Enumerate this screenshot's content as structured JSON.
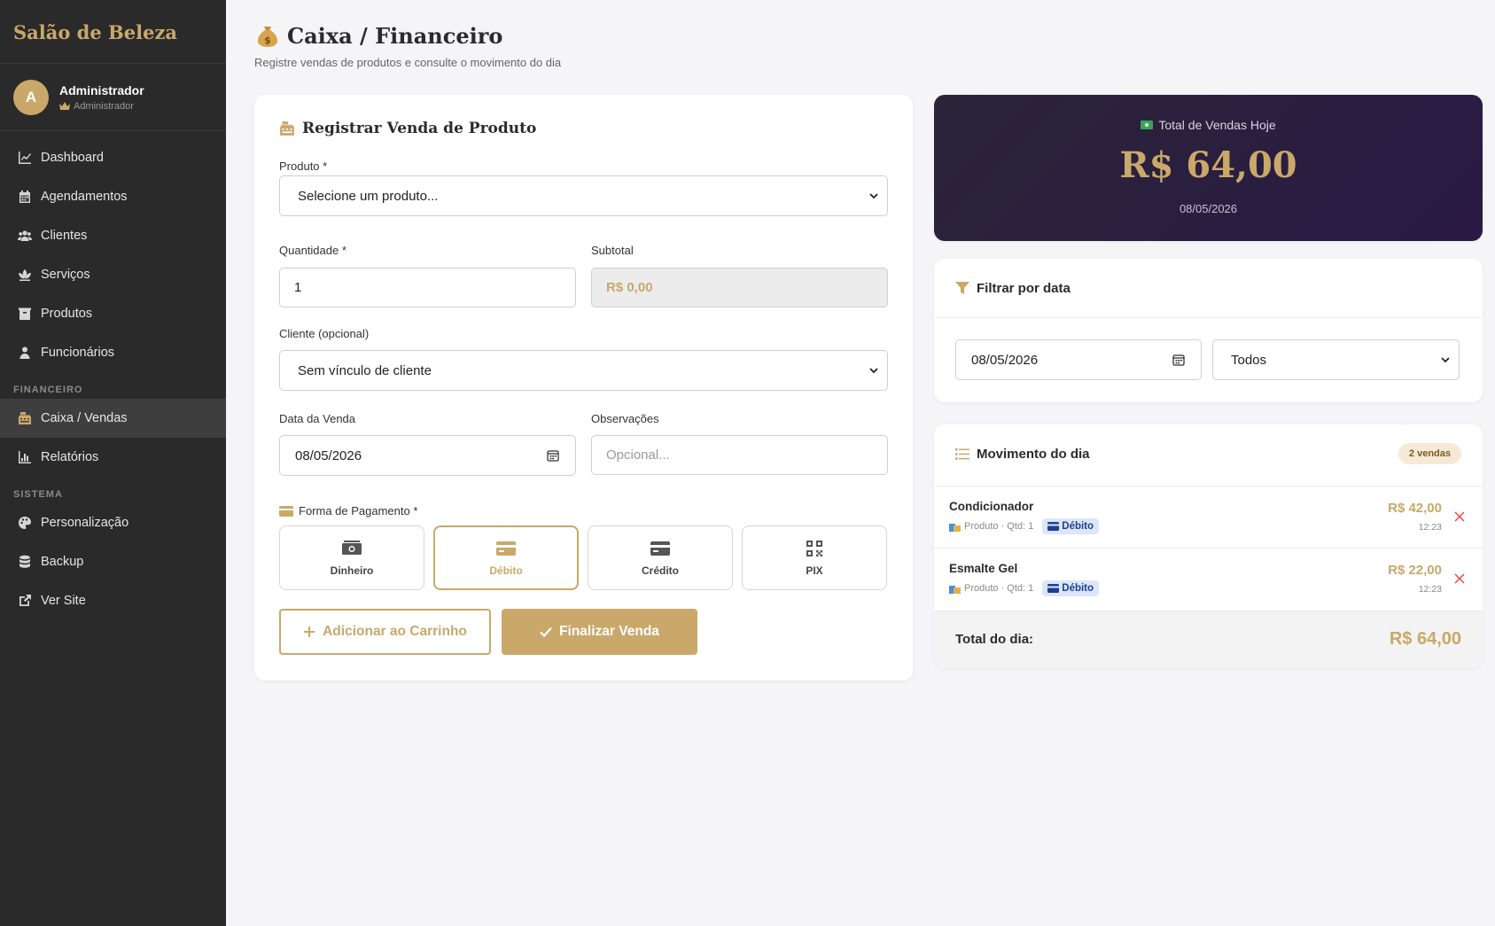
{
  "sidebar": {
    "brand": "Salão de Beleza",
    "user": {
      "initial": "A",
      "name": "Administrador",
      "role": "Administrador"
    },
    "items": [
      {
        "label": "Dashboard",
        "icon": "chart-line-icon"
      },
      {
        "label": "Agendamentos",
        "icon": "calendar-icon"
      },
      {
        "label": "Clientes",
        "icon": "users-icon"
      },
      {
        "label": "Serviços",
        "icon": "spa-icon"
      },
      {
        "label": "Produtos",
        "icon": "box-icon"
      },
      {
        "label": "Funcionários",
        "icon": "user-icon"
      }
    ],
    "section_financeiro": "FINANCEIRO",
    "financeiro_items": [
      {
        "label": "Caixa / Vendas",
        "icon": "cash-register-icon",
        "active": true
      },
      {
        "label": "Relatórios",
        "icon": "chart-bar-icon"
      }
    ],
    "section_sistema": "SISTEMA",
    "sistema_items": [
      {
        "label": "Personalização",
        "icon": "palette-icon"
      },
      {
        "label": "Backup",
        "icon": "database-icon"
      },
      {
        "label": "Ver Site",
        "icon": "external-link-icon"
      }
    ]
  },
  "header": {
    "title": "Caixa / Financeiro",
    "subtitle": "Registre vendas de produtos e consulte o movimento do dia"
  },
  "form": {
    "title": "Registrar Venda de Produto",
    "produto_label": "Produto *",
    "produto_value": "Selecione um produto...",
    "quantidade_label": "Quantidade *",
    "quantidade_value": "1",
    "subtotal_label": "Subtotal",
    "subtotal_value": "R$ 0,00",
    "cliente_label": "Cliente (opcional)",
    "cliente_value": "Sem vínculo de cliente",
    "data_label": "Data da Venda",
    "data_value": "08/05/2026",
    "obs_label": "Observações",
    "obs_placeholder": "Opcional...",
    "pagamento_label": "Forma de Pagamento *",
    "pagamento_options": [
      "Dinheiro",
      "Débito",
      "Crédito",
      "PIX"
    ],
    "pagamento_selected": "Débito",
    "add_cart_label": "Adicionar ao Carrinho",
    "finalize_label": "Finalizar Venda"
  },
  "total": {
    "label": "Total de Vendas Hoje",
    "value": "R$ 64,00",
    "date": "08/05/2026"
  },
  "filter": {
    "title": "Filtrar por data",
    "date_value": "08/05/2026",
    "select_value": "Todos"
  },
  "movimento": {
    "title": "Movimento do dia",
    "badge": "2 vendas",
    "rows": [
      {
        "name": "Condicionador",
        "meta": "Produto · Qtd: 1",
        "pay": "Débito",
        "value": "R$ 42,00",
        "time": "12:23"
      },
      {
        "name": "Esmalte Gel",
        "meta": "Produto · Qtd: 1",
        "pay": "Débito",
        "value": "R$ 22,00",
        "time": "12:23"
      }
    ],
    "footer_label": "Total do dia:",
    "footer_value": "R$ 64,00"
  },
  "colors": {
    "accent": "#c9a86a",
    "sidebar_bg": "#2a2a2a",
    "total_bg": "#2a1a45",
    "pill_bg": "#dbe6fb"
  }
}
